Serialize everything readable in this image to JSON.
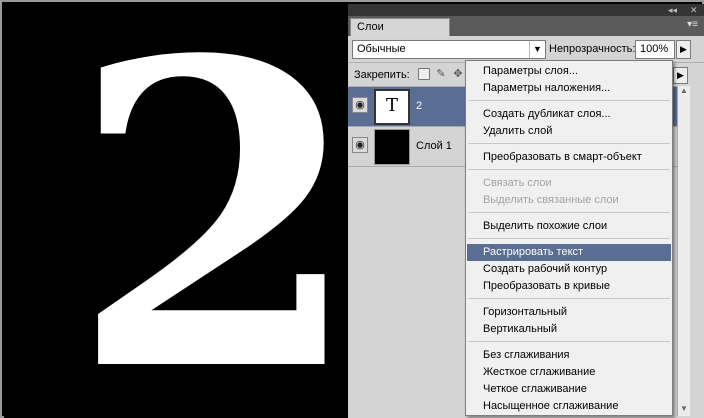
{
  "canvas": {
    "digit": "2"
  },
  "panel": {
    "tab_label": "Слои",
    "menu_icon": "panel-menu-icon",
    "blend_mode": "Обычные",
    "opacity_label": "Непрозрачность:",
    "opacity_value": "100%",
    "lock_label": "Закрепить:",
    "layers": [
      {
        "name": "2",
        "type": "text",
        "thumb_glyph": "T",
        "selected": true
      },
      {
        "name": "Слой 1",
        "type": "fill",
        "selected": false
      }
    ]
  },
  "context_menu": {
    "items": [
      {
        "label": "Параметры слоя...",
        "state": "enabled"
      },
      {
        "label": "Параметры наложения...",
        "state": "enabled"
      },
      {
        "label": "Создать дубликат слоя...",
        "state": "enabled"
      },
      {
        "label": "Удалить слой",
        "state": "enabled"
      },
      {
        "label": "Преобразовать в смарт-объект",
        "state": "enabled"
      },
      {
        "label": "Связать слои",
        "state": "disabled"
      },
      {
        "label": "Выделить связанные слои",
        "state": "disabled"
      },
      {
        "label": "Выделить похожие слои",
        "state": "enabled"
      },
      {
        "label": "Растрировать текст",
        "state": "highlighted"
      },
      {
        "label": "Создать рабочий контур",
        "state": "enabled"
      },
      {
        "label": "Преобразовать в кривые",
        "state": "enabled"
      },
      {
        "label": "Горизонтальный",
        "state": "enabled"
      },
      {
        "label": "Вертикальный",
        "state": "enabled"
      },
      {
        "label": "Без сглаживания",
        "state": "enabled"
      },
      {
        "label": "Жесткое сглаживание",
        "state": "enabled"
      },
      {
        "label": "Четкое сглаживание",
        "state": "enabled"
      },
      {
        "label": "Насыщенное сглаживание",
        "state": "enabled"
      }
    ]
  },
  "colors": {
    "selection": "#5a6d93",
    "canvas_bg": "#000000",
    "digit": "#ffffff"
  }
}
